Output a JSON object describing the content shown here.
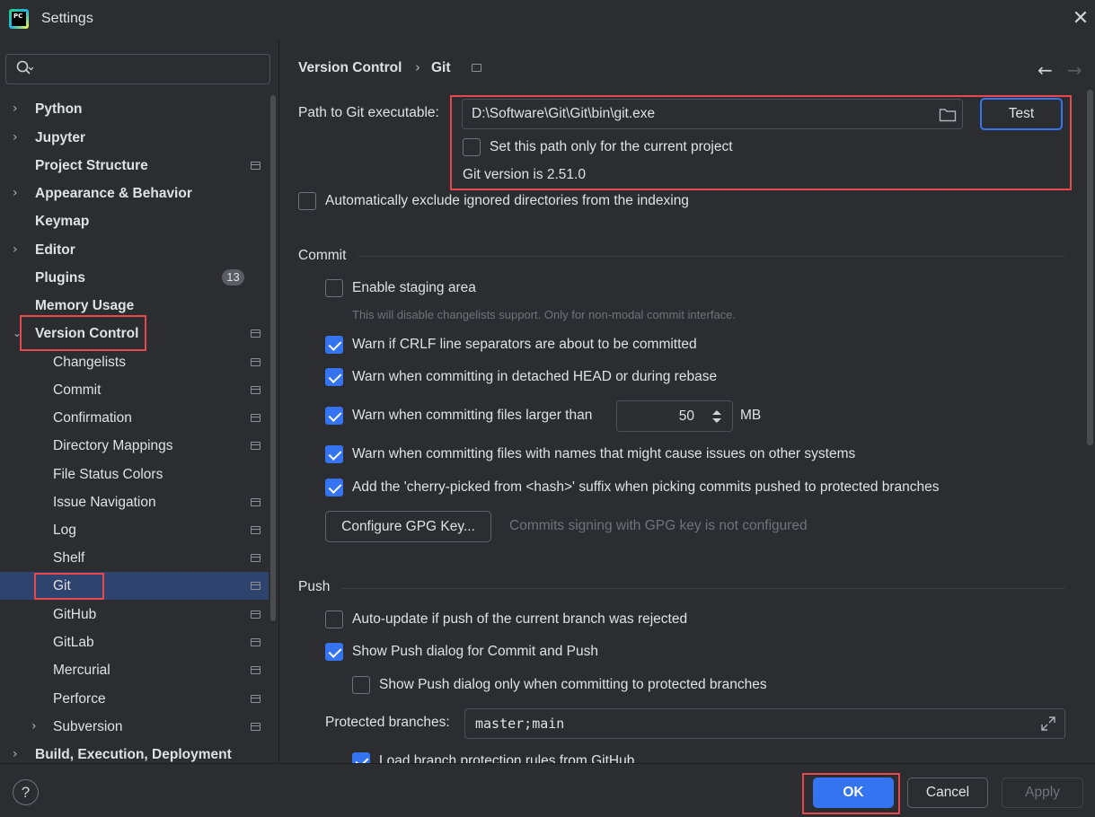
{
  "window": {
    "title": "Settings",
    "logo_text": "PC",
    "close": "✕"
  },
  "search": {
    "placeholder": ""
  },
  "sidebar": {
    "items": [
      {
        "label": "Python"
      },
      {
        "label": "Jupyter"
      },
      {
        "label": "Project Structure"
      },
      {
        "label": "Appearance & Behavior"
      },
      {
        "label": "Keymap"
      },
      {
        "label": "Editor"
      },
      {
        "label": "Plugins",
        "badge": "13"
      },
      {
        "label": "Memory Usage"
      },
      {
        "label": "Version Control"
      },
      {
        "label": "Changelists"
      },
      {
        "label": "Commit"
      },
      {
        "label": "Confirmation"
      },
      {
        "label": "Directory Mappings"
      },
      {
        "label": "File Status Colors"
      },
      {
        "label": "Issue Navigation"
      },
      {
        "label": "Log"
      },
      {
        "label": "Shelf"
      },
      {
        "label": "Git"
      },
      {
        "label": "GitHub"
      },
      {
        "label": "GitLab"
      },
      {
        "label": "Mercurial"
      },
      {
        "label": "Perforce"
      },
      {
        "label": "Subversion"
      },
      {
        "label": "Build, Execution, Deployment"
      }
    ]
  },
  "breadcrumb": {
    "parent": "Version Control",
    "separator": "›",
    "current": "Git"
  },
  "nav": {
    "back": "←",
    "forward": "→"
  },
  "git": {
    "path_label": "Path to Git executable:",
    "path_value": "D:\\Software\\Git\\Git\\bin\\git.exe",
    "test_button": "Test",
    "current_project_only": {
      "label": "Set this path only for the current project",
      "checked": false
    },
    "version_text": "Git version is 2.51.0",
    "exclude_ignored": {
      "label": "Automatically exclude ignored directories from the indexing",
      "checked": false
    }
  },
  "commit": {
    "section_title": "Commit",
    "staging": {
      "label": "Enable staging area",
      "checked": false,
      "hint": "This will disable changelists support. Only for non-modal commit interface."
    },
    "crlf": {
      "label": "Warn if CRLF line separators are about to be committed",
      "checked": true
    },
    "detached": {
      "label": "Warn when committing in detached HEAD or during rebase",
      "checked": true
    },
    "large_files": {
      "label": "Warn when committing files larger than",
      "checked": true,
      "value": "50",
      "unit": "MB"
    },
    "bad_names": {
      "label": "Warn when committing files with names that might cause issues on other systems",
      "checked": true
    },
    "cherry_pick": {
      "label": "Add the 'cherry-picked from <hash>' suffix when picking commits pushed to protected branches",
      "checked": true
    },
    "gpg_button": "Configure GPG Key...",
    "gpg_status": "Commits signing with GPG key is not configured"
  },
  "push": {
    "section_title": "Push",
    "auto_update": {
      "label": "Auto-update if push of the current branch was rejected",
      "checked": false
    },
    "show_dialog": {
      "label": "Show Push dialog for Commit and Push",
      "checked": true
    },
    "show_dialog_protected": {
      "label": "Show Push dialog only when committing to protected branches",
      "checked": false
    },
    "protected_label": "Protected branches:",
    "protected_value": "master;main",
    "load_rules": {
      "label": "Load branch protection rules from GitHub",
      "checked": true
    }
  },
  "footer": {
    "help": "?",
    "ok": "OK",
    "cancel": "Cancel",
    "apply": "Apply"
  },
  "colors": {
    "accent": "#3574f0",
    "highlight_box": "#e5484d",
    "selection": "#2e436e",
    "background": "#2b2d30"
  }
}
